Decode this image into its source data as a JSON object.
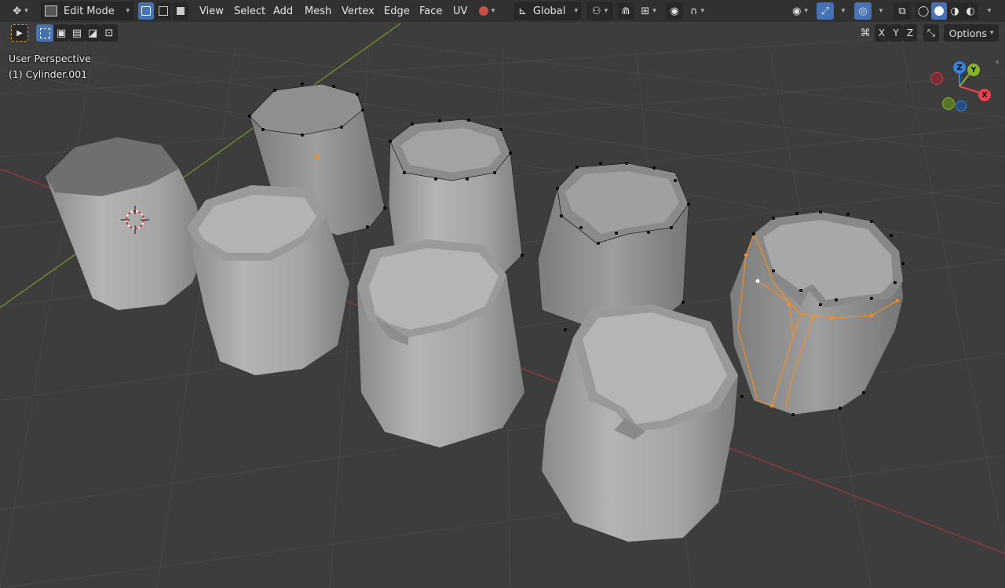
{
  "header": {
    "mode": "Edit Mode",
    "menus": [
      "View",
      "Select",
      "Add",
      "Mesh",
      "Vertex",
      "Edge",
      "Face",
      "UV"
    ],
    "transform_orientation": "Global"
  },
  "tool_header": {
    "axes": [
      "X",
      "Y",
      "Z"
    ],
    "options_label": "Options"
  },
  "viewport": {
    "view_name": "User Perspective",
    "object_name": "(1) Cylinder.001"
  },
  "gizmo": {
    "z_label": "Z",
    "y_label": "Y",
    "x_label": "X",
    "colors": {
      "x": "#e8434f",
      "y": "#84b52b",
      "z": "#2f83e3"
    }
  },
  "colors": {
    "background": "#3d3d3d",
    "grid": "#4a4a4a",
    "x_axis": "#8c3a3f",
    "y_axis": "#6b8a2a",
    "mesh": "#a9a9a9",
    "selection": "#ff8c1a",
    "accent": "#4772b3"
  }
}
